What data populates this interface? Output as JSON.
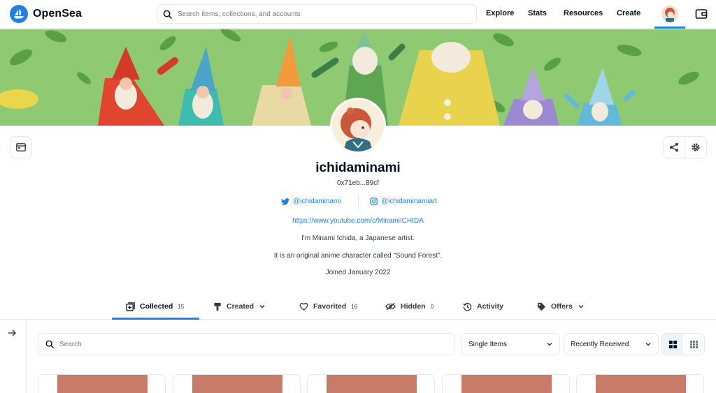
{
  "header": {
    "brand": "OpenSea",
    "search_placeholder": "Search items, collections, and accounts",
    "nav": [
      "Explore",
      "Stats",
      "Resources",
      "Create"
    ]
  },
  "profile": {
    "username": "ichidaminami",
    "address": "0x71eb...89cf",
    "twitter": "@ichidaminami",
    "instagram": "@ichidaminamiart",
    "website": "https://www.youtube.com/c/MinamiICHIDA",
    "bio_lines": [
      "I'm Minami Ichida, a Japanese artist.",
      "It is an original anime character called \"Sound Forest\"."
    ],
    "joined": "Joined January 2022"
  },
  "tabs": [
    {
      "label": "Collected",
      "count": "15",
      "icon": "collected-icon",
      "active": true
    },
    {
      "label": "Created",
      "count": "",
      "icon": "brush-icon",
      "dropdown": true
    },
    {
      "label": "Favorited",
      "count": "16",
      "icon": "heart-icon"
    },
    {
      "label": "Hidden",
      "count": "0",
      "icon": "eye-off-icon"
    },
    {
      "label": "Activity",
      "count": "",
      "icon": "history-icon"
    },
    {
      "label": "Offers",
      "count": "",
      "icon": "tag-icon",
      "dropdown": true
    }
  ],
  "filters": {
    "search_placeholder": "Search",
    "item_type": "Single Items",
    "sort": "Recently Received",
    "view": "grid"
  },
  "colors": {
    "accent": "#2081e2",
    "banner_bg": "#8fc971",
    "card_art": "#c77c6a",
    "text": "#04111d",
    "border": "#e5e8eb"
  },
  "cards_visible": 5
}
